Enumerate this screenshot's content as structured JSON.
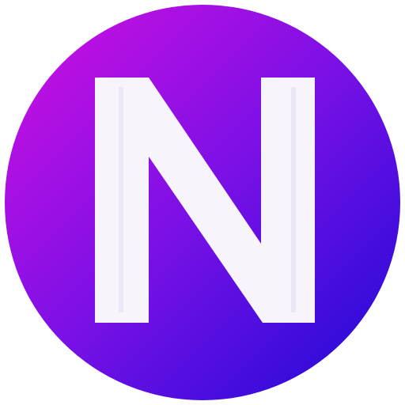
{
  "logo": {
    "letter": "N",
    "gradient_start": "#d30fe0",
    "gradient_mid": "#7a10e6",
    "gradient_end": "#1a0bd6",
    "letter_color": "#f7f4fb",
    "letter_shadow": "#e6def2"
  }
}
